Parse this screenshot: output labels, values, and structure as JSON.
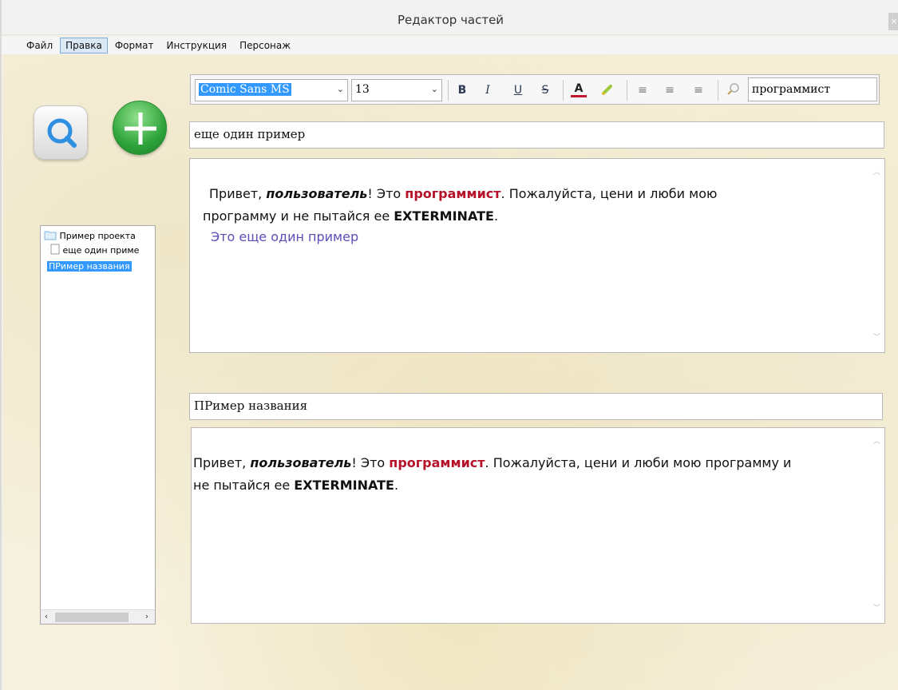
{
  "window": {
    "title": "Редактор частей",
    "close": "×"
  },
  "menu": [
    "Файл",
    "Правка",
    "Формат",
    "Инструкция",
    "Персонаж"
  ],
  "tree": {
    "project": "Пример проекта",
    "item1": "еще один приме",
    "item2": "ПРимер названия"
  },
  "toolbar": {
    "font": "Comic Sans MS",
    "size": "13",
    "bold": "B",
    "italic": "I",
    "underline": "U",
    "strike": "S",
    "text_color": "A",
    "align_left": "≡",
    "align_center": "≡",
    "align_right": "≡",
    "search_value": "программист"
  },
  "part1": {
    "title": "еще один пример",
    "t1": "Привет, ",
    "t2": "пользователь",
    "t3": "! Это ",
    "t4": "программист",
    "t5": ". Пожалуйста, цени и люби мою",
    "t6": "программу и не пытайся ее ",
    "t7": "EXTERMINATE",
    "t8": ".",
    "t9": "Это еще один пример"
  },
  "part2": {
    "title": "ПРимер названия",
    "t1": "Привет, ",
    "t2": "пользователь",
    "t3": "! Это ",
    "t4": "программист",
    "t5": ". Пожалуйста, цени и люби мою программу и",
    "t6": "не пытайся ее ",
    "t7": "EXTERMINATE",
    "t8": "."
  },
  "colors": {
    "accent_red": "#b5122a",
    "link_blue": "#5b4fb5",
    "selection": "#3399ff"
  }
}
